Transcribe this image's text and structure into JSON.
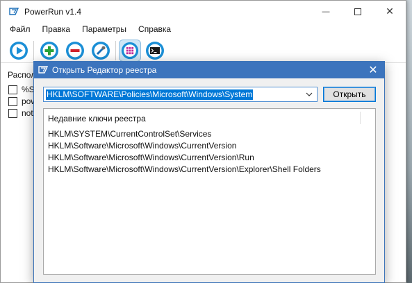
{
  "app": {
    "title": "PowerRun v1.4",
    "controls": {
      "minimize": "—",
      "close": "✕"
    }
  },
  "menu": [
    "Файл",
    "Правка",
    "Параметры",
    "Справка"
  ],
  "toolbar": {
    "buttons": [
      {
        "name": "run",
        "icon": "play-icon"
      },
      {
        "name": "add",
        "icon": "plus-icon"
      },
      {
        "name": "remove",
        "icon": "minus-icon"
      },
      {
        "name": "edit",
        "icon": "edit-icon"
      },
      {
        "name": "registry",
        "icon": "grid-icon",
        "pressed": true
      },
      {
        "name": "cmd",
        "icon": "console-icon"
      }
    ],
    "accent": "#1b8fd6"
  },
  "side_panel": {
    "label": "Располо",
    "items": [
      "%Sy",
      "pow",
      "note"
    ]
  },
  "dialog": {
    "title": "Открыть Редактор реестра",
    "combo_value": "HKLM\\SOFTWARE\\Policies\\Microsoft\\Windows\\System",
    "open_button": "Открыть",
    "close": "✕",
    "list_header": "Недавние ключи реестра",
    "recent_keys": [
      "HKLM\\SYSTEM\\CurrentControlSet\\Services",
      "HKLM\\Software\\Microsoft\\Windows\\CurrentVersion",
      "HKLM\\Software\\Microsoft\\Windows\\CurrentVersion\\Run",
      "HKLM\\Software\\Microsoft\\Windows\\CurrentVersion\\Explorer\\Shell Folders"
    ],
    "title_color": "#3c74bd"
  }
}
